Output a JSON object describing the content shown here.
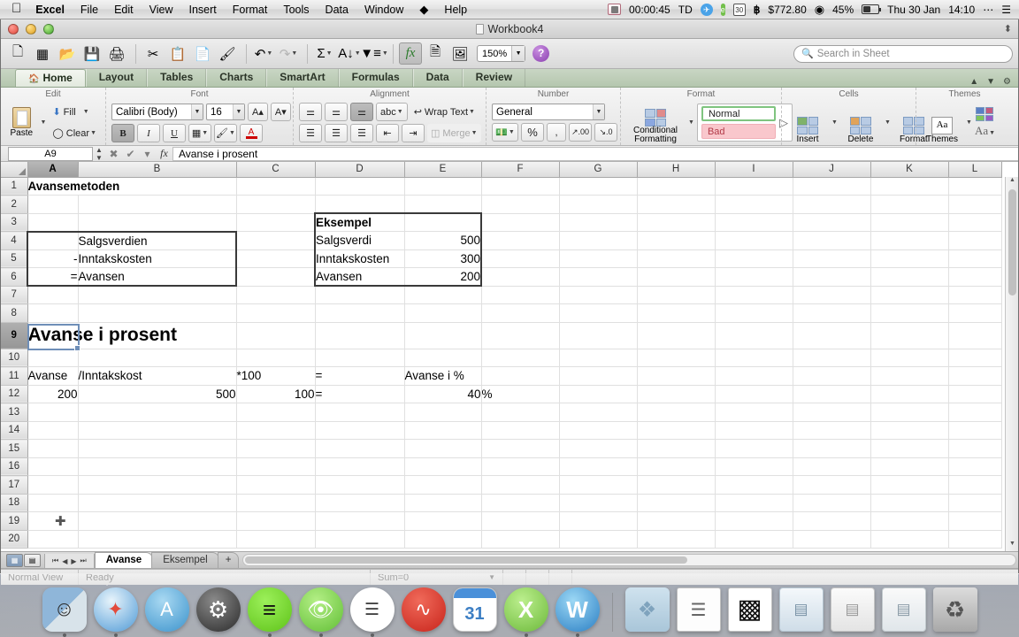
{
  "menubar": {
    "apple": "apple-logo",
    "items": [
      "Excel",
      "File",
      "Edit",
      "View",
      "Insert",
      "Format",
      "Tools",
      "Data",
      "Window",
      "Help"
    ],
    "right": {
      "recording_time": "00:00:45",
      "textexpander": "TD",
      "bitcoin_price": "$772.80",
      "battery_percent": "45%",
      "date": "Thu 30 Jan",
      "time": "14:10"
    }
  },
  "window": {
    "title": "Workbook4"
  },
  "toolbar": {
    "zoom": "150%",
    "search_placeholder": "Search in Sheet"
  },
  "ribbon": {
    "tabs": [
      {
        "label": "Home",
        "active": true
      },
      {
        "label": "Layout",
        "active": false
      },
      {
        "label": "Tables",
        "active": false
      },
      {
        "label": "Charts",
        "active": false
      },
      {
        "label": "SmartArt",
        "active": false
      },
      {
        "label": "Formulas",
        "active": false
      },
      {
        "label": "Data",
        "active": false
      },
      {
        "label": "Review",
        "active": false
      }
    ],
    "groups": {
      "edit": {
        "title": "Edit",
        "paste": "Paste",
        "fill": "Fill",
        "clear": "Clear"
      },
      "font": {
        "title": "Font",
        "font_name": "Calibri (Body)",
        "font_size": "16",
        "grow": "A",
        "shrink": "A",
        "bold": "B",
        "italic": "I",
        "underline": "U"
      },
      "alignment": {
        "title": "Alignment",
        "orientation": "abc",
        "wrap_text": "Wrap Text",
        "merge": "Merge"
      },
      "number": {
        "title": "Number",
        "format": "General",
        "percent": "%",
        "comma": ","
      },
      "format": {
        "title": "Format",
        "conditional_formatting": "Conditional Formatting",
        "style_normal": "Normal",
        "style_bad": "Bad"
      },
      "cells": {
        "title": "Cells",
        "insert": "Insert",
        "delete": "Delete",
        "format": "Format"
      },
      "themes": {
        "title": "Themes",
        "themes": "Themes",
        "text_styles": "Aa"
      }
    }
  },
  "formula_bar": {
    "name_box": "A9",
    "formula": "Avanse i prosent"
  },
  "sheet": {
    "columns": [
      "A",
      "B",
      "C",
      "D",
      "E",
      "F",
      "G",
      "H",
      "I",
      "J",
      "K",
      "L"
    ],
    "selected_column": "A",
    "selected_row": 9,
    "rows": [
      {
        "n": 1,
        "cells": {
          "A": "Avansemetoden"
        }
      },
      {
        "n": 2,
        "cells": {}
      },
      {
        "n": 3,
        "cells": {
          "D": "Eksempel"
        }
      },
      {
        "n": 4,
        "cells": {
          "B": "Salgsverdien",
          "D": "Salgsverdi",
          "E": "500"
        }
      },
      {
        "n": 5,
        "cells": {
          "A": "-",
          "B": "Inntakskosten",
          "D": "Inntakskosten",
          "E": "300"
        }
      },
      {
        "n": 6,
        "cells": {
          "A": "=",
          "B": "Avansen",
          "D": "Avansen",
          "E": "200"
        }
      },
      {
        "n": 7,
        "cells": {}
      },
      {
        "n": 8,
        "cells": {}
      },
      {
        "n": 9,
        "cells": {
          "A": "Avanse i prosent"
        }
      },
      {
        "n": 10,
        "cells": {}
      },
      {
        "n": 11,
        "cells": {
          "A": "Avanse",
          "B": "/Inntakskost",
          "C": "*100",
          "D": "=",
          "E": "Avanse i %"
        }
      },
      {
        "n": 12,
        "cells": {
          "A": "200",
          "B": "500",
          "C": "100",
          "D": "=",
          "E": "40",
          "F": "%"
        }
      },
      {
        "n": 13,
        "cells": {}
      },
      {
        "n": 14,
        "cells": {}
      },
      {
        "n": 15,
        "cells": {}
      },
      {
        "n": 16,
        "cells": {}
      },
      {
        "n": 17,
        "cells": {}
      },
      {
        "n": 18,
        "cells": {}
      },
      {
        "n": 19,
        "cells": {}
      },
      {
        "n": 20,
        "cells": {}
      }
    ]
  },
  "sheet_tabs": {
    "tabs": [
      {
        "label": "Avanse",
        "active": true
      },
      {
        "label": "Eksempel",
        "active": false
      }
    ],
    "add_label": "+"
  },
  "statusbar": {
    "view": "Normal View",
    "state": "Ready",
    "sum": "Sum=0"
  },
  "dock": {
    "items": [
      {
        "name": "finder",
        "glyph": "◑"
      },
      {
        "name": "safari",
        "glyph": "✦"
      },
      {
        "name": "app-store",
        "glyph": "A"
      },
      {
        "name": "system-preferences",
        "glyph": "⚙"
      },
      {
        "name": "spotify",
        "glyph": "≡"
      },
      {
        "name": "evernote",
        "glyph": "Е"
      },
      {
        "name": "wunderlist",
        "glyph": "☰"
      },
      {
        "name": "istat-menus",
        "glyph": "⌇"
      },
      {
        "name": "calendar",
        "glyph": "31"
      },
      {
        "name": "excel",
        "glyph": "X"
      },
      {
        "name": "word",
        "glyph": "W"
      },
      {
        "name": "dropbox-folder",
        "glyph": "❖"
      },
      {
        "name": "document-stack",
        "glyph": "☰"
      },
      {
        "name": "qr-code",
        "glyph": "▓"
      },
      {
        "name": "minimized-window-1",
        "glyph": "▤"
      },
      {
        "name": "minimized-window-2",
        "glyph": "▤"
      },
      {
        "name": "minimized-window-3",
        "glyph": "▤"
      },
      {
        "name": "trash",
        "glyph": "Ὕ1"
      }
    ]
  }
}
